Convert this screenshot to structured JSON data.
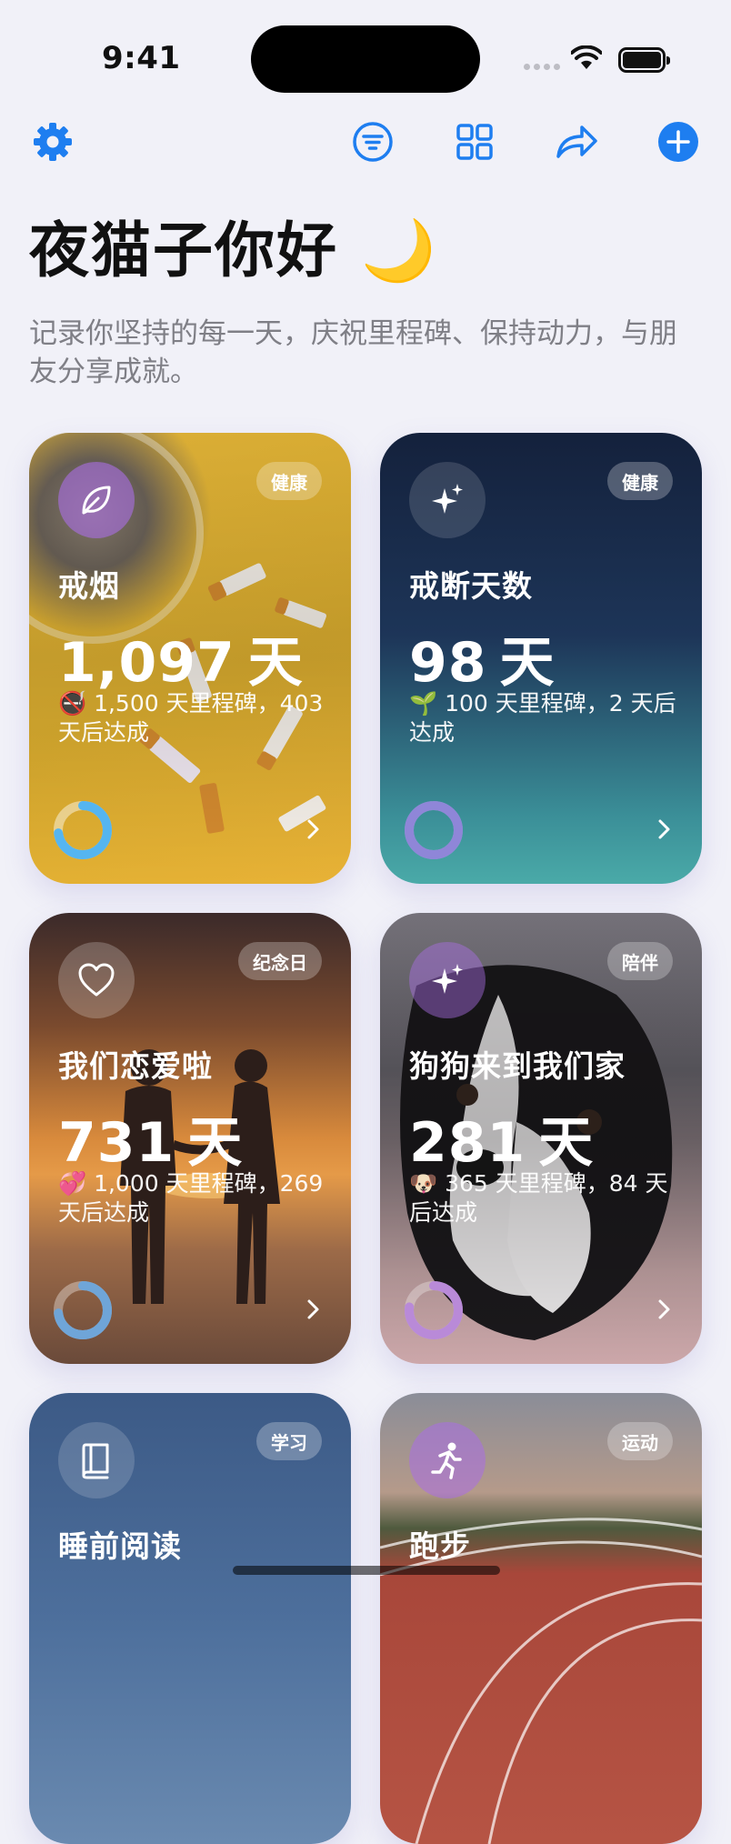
{
  "status_bar": {
    "time": "9:41"
  },
  "toolbar": {
    "settings_icon": "gear-icon",
    "filter_icon": "filter-icon",
    "grid_icon": "grid-icon",
    "share_icon": "share-icon",
    "add_icon": "plus-icon",
    "accent_color": "#1e7ef0"
  },
  "header": {
    "title": "夜猫子你好 🌙",
    "subtitle": "记录你坚持的每一天，庆祝里程碑、保持动力，与朋友分享成就。"
  },
  "cards": [
    {
      "name": "戒烟",
      "count": "1,097",
      "unit": "天",
      "tag": "健康",
      "milestone": "🚭 1,500 天里程碑，403 天后达成",
      "progress": 0.73,
      "icon": "leaf-icon",
      "theme": "#e5b52a"
    },
    {
      "name": "戒断天数",
      "count": "98",
      "unit": "天",
      "tag": "健康",
      "milestone": "🌱 100 天里程碑，2 天后达成",
      "progress": 0.98,
      "icon": "sparkles-icon",
      "theme": "#1f2f52"
    },
    {
      "name": "我们恋爱啦",
      "count": "731",
      "unit": "天",
      "tag": "纪念日",
      "milestone": "💞 1,000 天里程碑，269 天后达成",
      "progress": 0.73,
      "icon": "heart-icon",
      "theme": "#b06a35"
    },
    {
      "name": "狗狗来到我们家",
      "count": "281",
      "unit": "天",
      "tag": "陪伴",
      "milestone": "🐶 365 天里程碑，84 天后达成",
      "progress": 0.77,
      "icon": "sparkles-icon",
      "theme": "#505058"
    },
    {
      "name": "睡前阅读",
      "count": "",
      "unit": "",
      "tag": "学习",
      "milestone": "",
      "progress": 0,
      "icon": "book-icon",
      "theme": "#3e5f90"
    },
    {
      "name": "跑步",
      "count": "",
      "unit": "",
      "tag": "运动",
      "milestone": "",
      "progress": 0,
      "icon": "running-icon",
      "theme": "#8a6b5a"
    }
  ]
}
